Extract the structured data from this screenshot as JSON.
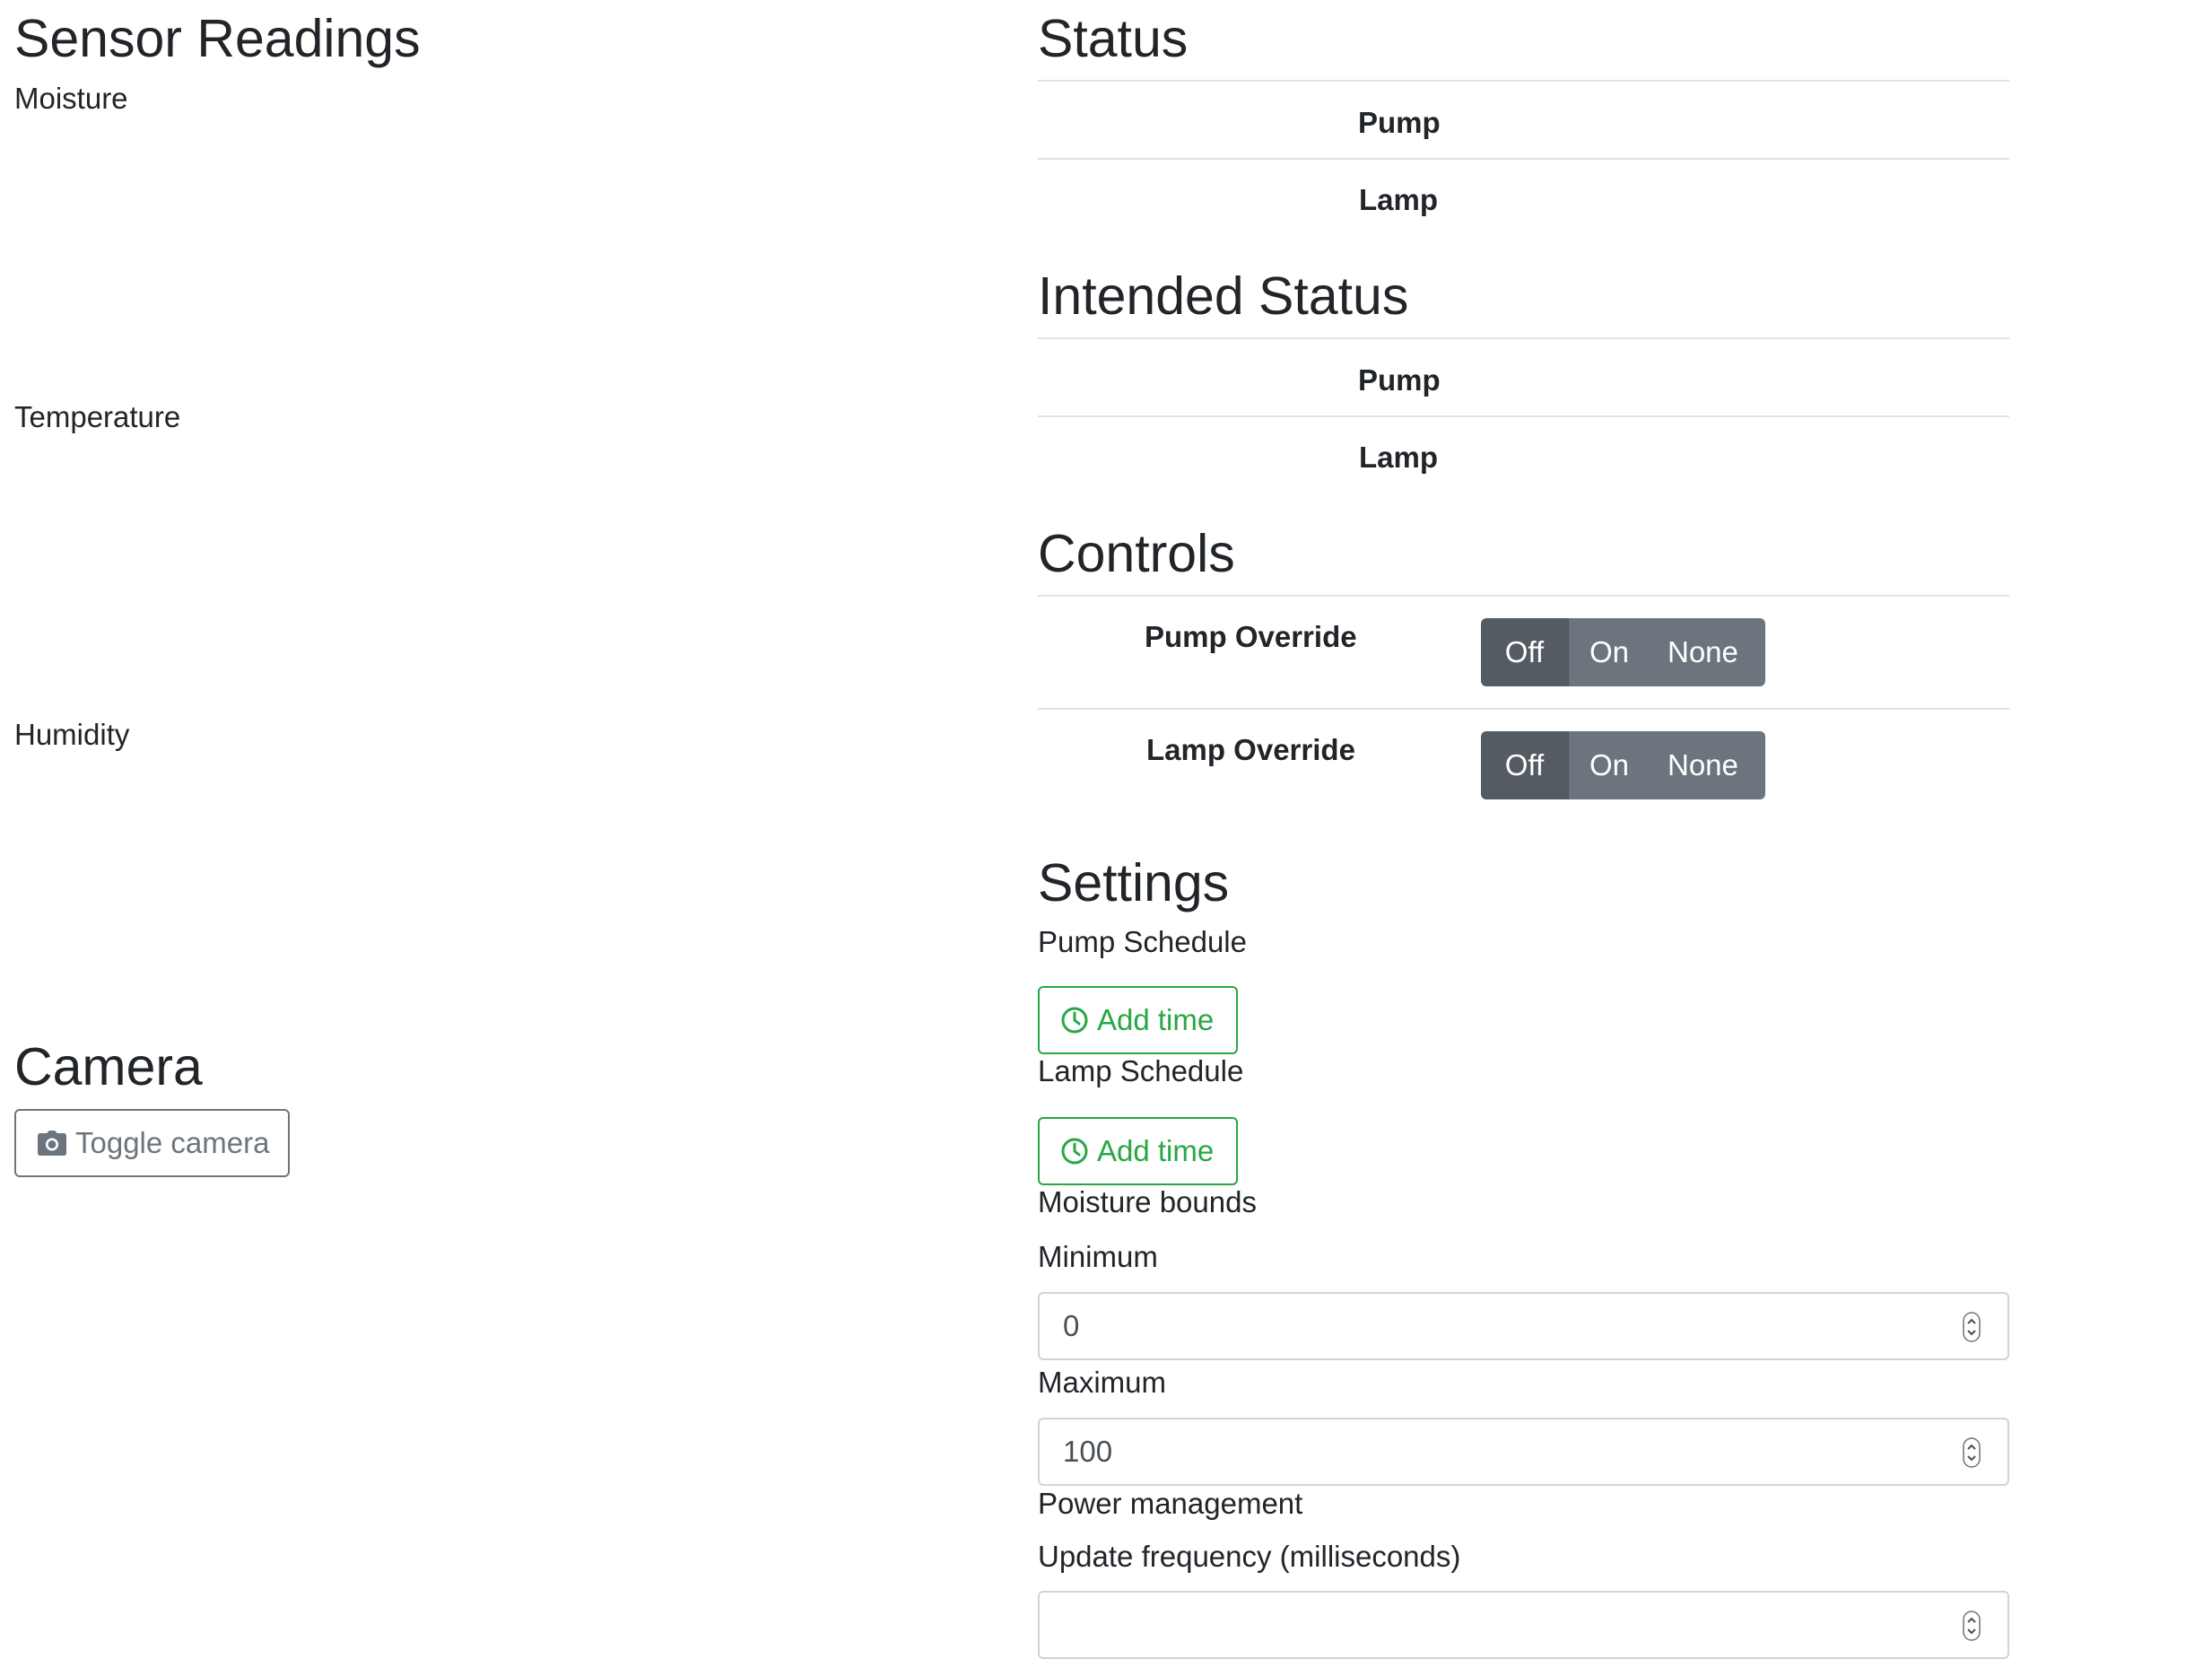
{
  "sensors": {
    "heading": "Sensor Readings",
    "moisture_label": "Moisture",
    "temperature_label": "Temperature",
    "humidity_label": "Humidity"
  },
  "camera": {
    "heading": "Camera",
    "toggle_label": "Toggle camera",
    "toggle_icon": "camera-icon"
  },
  "status": {
    "heading": "Status",
    "rows": [
      {
        "label": "Pump",
        "value": ""
      },
      {
        "label": "Lamp",
        "value": ""
      }
    ]
  },
  "intended_status": {
    "heading": "Intended Status",
    "rows": [
      {
        "label": "Pump",
        "value": ""
      },
      {
        "label": "Lamp",
        "value": ""
      }
    ]
  },
  "controls": {
    "heading": "Controls",
    "overrides": [
      {
        "label": "Pump Override",
        "options": [
          "Off",
          "On",
          "None"
        ],
        "selected": "Off"
      },
      {
        "label": "Lamp Override",
        "options": [
          "Off",
          "On",
          "None"
        ],
        "selected": "Off"
      }
    ]
  },
  "settings": {
    "heading": "Settings",
    "pump_schedule": {
      "label": "Pump Schedule",
      "add_label": "Add time",
      "icon": "clock-icon"
    },
    "lamp_schedule": {
      "label": "Lamp Schedule",
      "add_label": "Add time",
      "icon": "clock-icon"
    },
    "moisture_bounds": {
      "label": "Moisture bounds",
      "minimum_label": "Minimum",
      "minimum_value": "0",
      "maximum_label": "Maximum",
      "maximum_value": "100"
    },
    "power": {
      "label": "Power management",
      "update_label": "Update frequency (milliseconds)",
      "update_value": ""
    }
  },
  "colors": {
    "success": "#28a745",
    "secondary": "#6c757d",
    "secondary_active": "#545b62",
    "text": "#212529",
    "border": "#dee2e6"
  }
}
